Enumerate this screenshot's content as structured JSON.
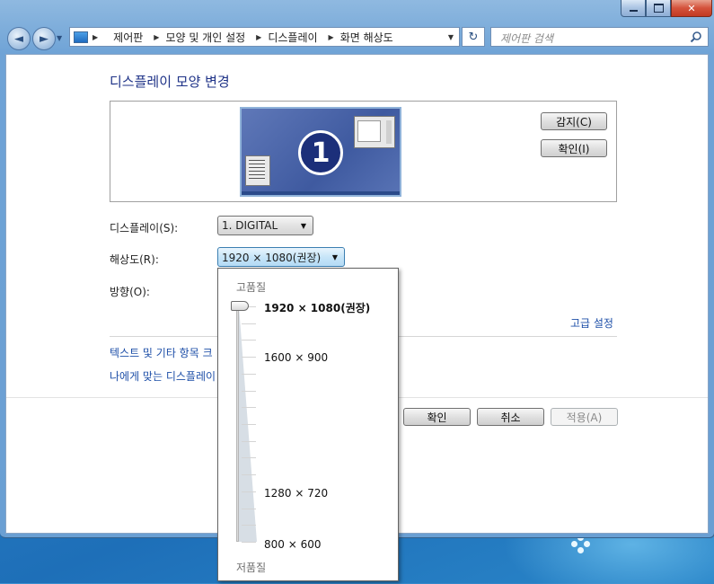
{
  "window": {
    "caption": {
      "close_glyph": "✕"
    },
    "nav": {
      "back_glyph": "◄",
      "forward_glyph": "►",
      "refresh_glyph": "↻"
    },
    "breadcrumb": [
      "제어판",
      "모양 및 개인 설정",
      "디스플레이",
      "화면 해상도"
    ],
    "search": {
      "placeholder": "제어판 검색"
    }
  },
  "main": {
    "title": "디스플레이 모양 변경",
    "preview": {
      "monitor_number": "1",
      "detect_button": "감지(C)",
      "identify_button": "확인(I)"
    },
    "display": {
      "label": "디스플레이(S):",
      "value": "1. DIGITAL"
    },
    "resolution": {
      "label": "해상도(R):",
      "value": "1920 × 1080(권장)"
    },
    "orientation": {
      "label": "방향(O):"
    },
    "advanced_link": "고급 설정",
    "links": [
      "텍스트 및 기타 항목 크",
      "나에게 맞는 디스플레이"
    ],
    "buttons": {
      "ok": "확인",
      "cancel": "취소",
      "apply": "적용(A)"
    }
  },
  "resolution_popup": {
    "high_quality": "고품질",
    "low_quality": "저품질",
    "selected_index": 0,
    "options": [
      "1920 × 1080(권장)",
      "1600 × 900",
      "1280 × 720",
      "800 × 600"
    ]
  },
  "colors": {
    "title_blue": "#1e3287",
    "link_blue": "#1e4fa8",
    "disabled_text": "#8a8a8a"
  }
}
